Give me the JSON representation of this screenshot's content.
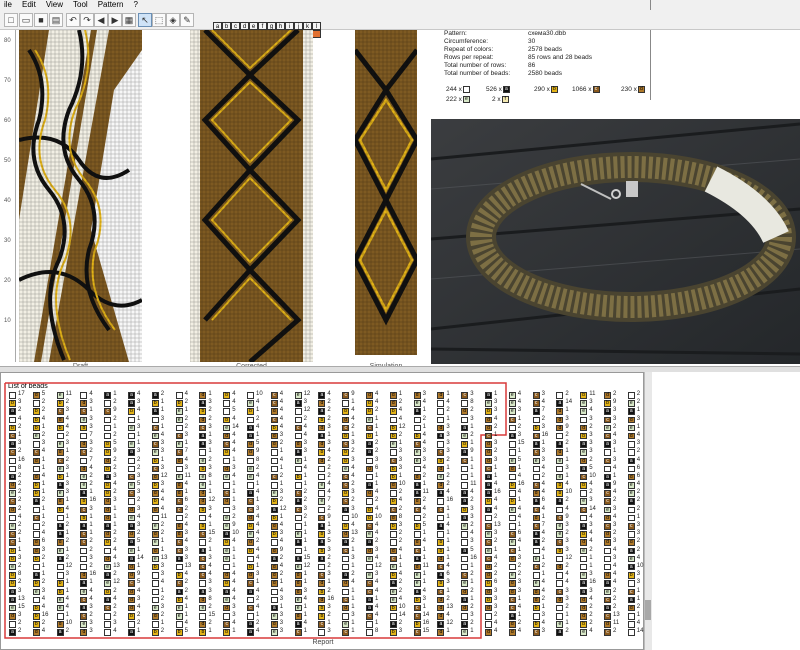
{
  "menu": [
    "ile",
    "Edit",
    "View",
    "Tool",
    "Pattern",
    "?"
  ],
  "toolbar": [
    "new-icon",
    "open-icon",
    "save-icon",
    "print-icon",
    "undo-icon",
    "redo-icon",
    "prev-icon",
    "next-icon",
    "image-icon",
    "pointer-icon",
    "select-icon",
    "fill-icon",
    "picker-icon"
  ],
  "palette": {
    "letters": [
      "a",
      "b",
      "c",
      "d",
      "e",
      "f",
      "g",
      "h",
      "i",
      "j",
      "k",
      "l"
    ],
    "colors": [
      "#111111",
      "#e3b317",
      "#8a5a1e",
      "#b07a2a",
      "#d8e8c8",
      "#f4e9b0",
      "#c03c3c",
      "#a040a0",
      "#3050c0",
      "#30a0c0",
      "#40b040",
      "#e07030"
    ]
  },
  "ruler": [
    "80",
    "70",
    "60",
    "50",
    "40",
    "30",
    "20",
    "10"
  ],
  "captions": {
    "draft": "Draft",
    "corrected": "Corrected",
    "simulation": "Simulation"
  },
  "info": [
    {
      "k": "Pattern:",
      "v": "схема30.dbb"
    },
    {
      "k": "Circumference:",
      "v": "30"
    },
    {
      "k": "Repeat of colors:",
      "v": "2578 beads"
    },
    {
      "k": "Rows per repeat:",
      "v": "85 rows and 28 beads"
    },
    {
      "k": "Total number of rows:",
      "v": "86"
    },
    {
      "k": "Total number of beads:",
      "v": "2580 beads"
    }
  ],
  "counts": [
    {
      "n": "244 x",
      "l": "",
      "c": "#ffffff"
    },
    {
      "n": "526 x",
      "l": "a",
      "c": "#111111"
    },
    {
      "n": "290 x",
      "l": "b",
      "c": "#e3b317"
    },
    {
      "n": "1066 x",
      "l": "c",
      "c": "#8a5a1e"
    },
    {
      "n": "230 x",
      "l": "d",
      "c": "#b07a2a"
    },
    {
      "n": "222 x",
      "l": "e",
      "c": "#d8e8c8"
    },
    {
      "n": "2 x",
      "l": "f",
      "c": "#f4e9b0"
    }
  ],
  "report": {
    "title": "List of beads",
    "footer": "Report",
    "first_value": "17",
    "legend": {
      "blank": "#ffffff",
      "a": "#111111",
      "b": "#e3b317",
      "c": "#8a5a1e",
      "d": "#b07a2a",
      "e": "#d8e8c8"
    }
  },
  "colors": {
    "brown": "#7e5a22",
    "black": "#111111",
    "gold": "#e3b317",
    "cream": "#f2efe4",
    "accent": "#d83a3a"
  }
}
